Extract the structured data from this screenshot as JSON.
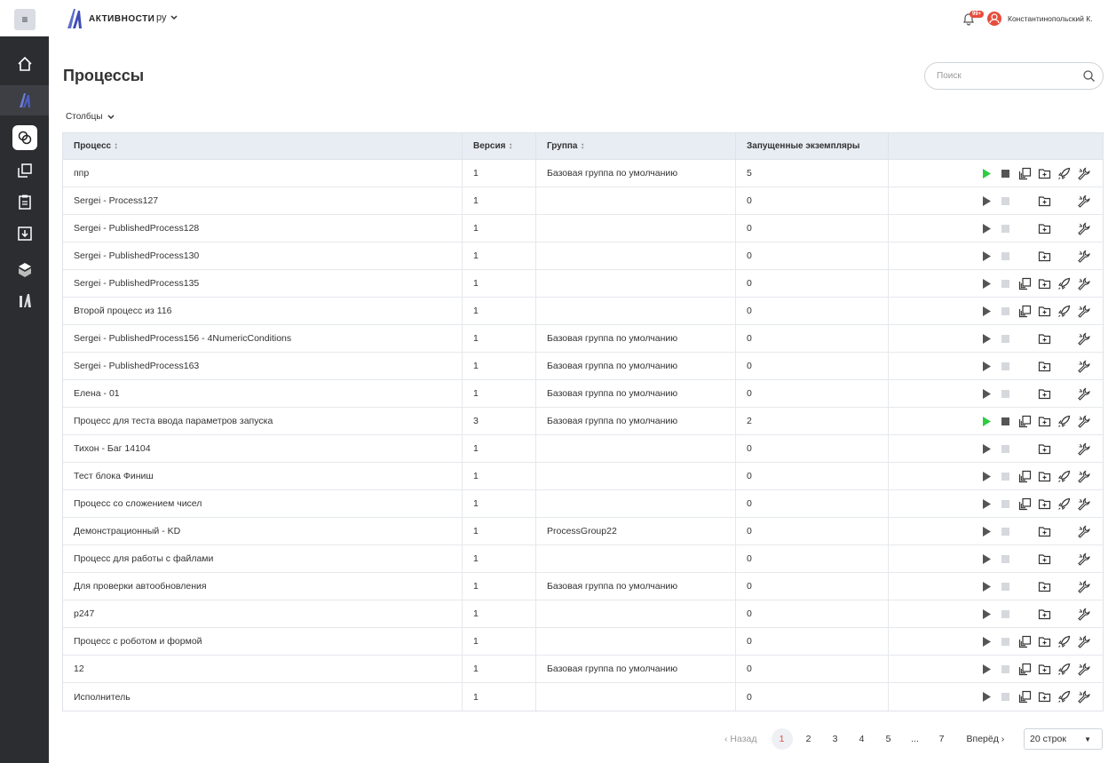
{
  "header": {
    "menu_icon": "hamburger-icon",
    "app_title": "АКТИВНОСТИ",
    "language": "ру",
    "notifications_badge": "99+",
    "user_name": "Константинопольский К."
  },
  "sidebar": {
    "items": [
      {
        "icon": "home-icon"
      },
      {
        "icon": "activities-logo-icon"
      },
      {
        "icon": "processes-icon"
      },
      {
        "icon": "copy-icon"
      },
      {
        "icon": "clipboard-icon"
      },
      {
        "icon": "inbox-download-icon"
      },
      {
        "icon": "package-icon"
      },
      {
        "icon": "alt-logo-icon"
      }
    ]
  },
  "main": {
    "title": "Процессы",
    "search_placeholder": "Поиск",
    "columns_label": "Столбцы",
    "columns": [
      {
        "label": "Процесс",
        "sortable": true
      },
      {
        "label": "Версия",
        "sortable": true
      },
      {
        "label": "Группа",
        "sortable": true
      },
      {
        "label": "Запущенные экземпляры",
        "sortable": false
      },
      {
        "label": "",
        "sortable": false
      }
    ],
    "rows": [
      {
        "name": "ппр",
        "version": "1",
        "group": "Базовая группа по умолчанию",
        "instances": "5",
        "running": true,
        "copy": true,
        "rocket": true
      },
      {
        "name": "Sergei - Process127",
        "version": "1",
        "group": "",
        "instances": "0",
        "running": false,
        "copy": false,
        "rocket": false
      },
      {
        "name": "Sergei - PublishedProcess128",
        "version": "1",
        "group": "",
        "instances": "0",
        "running": false,
        "copy": false,
        "rocket": false
      },
      {
        "name": "Sergei - PublishedProcess130",
        "version": "1",
        "group": "",
        "instances": "0",
        "running": false,
        "copy": false,
        "rocket": false
      },
      {
        "name": "Sergei - PublishedProcess135",
        "version": "1",
        "group": "",
        "instances": "0",
        "running": false,
        "copy": true,
        "rocket": true
      },
      {
        "name": "Второй процесс из 116",
        "version": "1",
        "group": "",
        "instances": "0",
        "running": false,
        "copy": true,
        "rocket": true
      },
      {
        "name": "Sergei - PublishedProcess156 - 4NumericConditions",
        "version": "1",
        "group": "Базовая группа по умолчанию",
        "instances": "0",
        "running": false,
        "copy": false,
        "rocket": false
      },
      {
        "name": "Sergei - PublishedProcess163",
        "version": "1",
        "group": "Базовая группа по умолчанию",
        "instances": "0",
        "running": false,
        "copy": false,
        "rocket": false
      },
      {
        "name": "Елена - 01",
        "version": "1",
        "group": "Базовая группа по умолчанию",
        "instances": "0",
        "running": false,
        "copy": false,
        "rocket": false
      },
      {
        "name": "Процесс для теста ввода параметров запуска",
        "version": "3",
        "group": "Базовая группа по умолчанию",
        "instances": "2",
        "running": true,
        "copy": true,
        "rocket": true
      },
      {
        "name": "Тихон - Баг 14104",
        "version": "1",
        "group": "",
        "instances": "0",
        "running": false,
        "copy": false,
        "rocket": false
      },
      {
        "name": "Тест блока Финиш",
        "version": "1",
        "group": "",
        "instances": "0",
        "running": false,
        "copy": true,
        "rocket": true
      },
      {
        "name": "Процесс со сложением чисел",
        "version": "1",
        "group": "",
        "instances": "0",
        "running": false,
        "copy": true,
        "rocket": true
      },
      {
        "name": "Демонстрационный - KD",
        "version": "1",
        "group": "ProcessGroup22",
        "instances": "0",
        "running": false,
        "copy": false,
        "rocket": false
      },
      {
        "name": "Процесс для работы с файлами",
        "version": "1",
        "group": "",
        "instances": "0",
        "running": false,
        "copy": false,
        "rocket": false
      },
      {
        "name": "Для проверки автообновления",
        "version": "1",
        "group": "Базовая группа по умолчанию",
        "instances": "0",
        "running": false,
        "copy": false,
        "rocket": false
      },
      {
        "name": "p247",
        "version": "1",
        "group": "",
        "instances": "0",
        "running": false,
        "copy": false,
        "rocket": false
      },
      {
        "name": "Процесс с роботом и формой",
        "version": "1",
        "group": "",
        "instances": "0",
        "running": false,
        "copy": true,
        "rocket": true
      },
      {
        "name": "12",
        "version": "1",
        "group": "Базовая группа по умолчанию",
        "instances": "0",
        "running": false,
        "copy": true,
        "rocket": true
      },
      {
        "name": "Исполнитель",
        "version": "1",
        "group": "",
        "instances": "0",
        "running": false,
        "copy": true,
        "rocket": true
      }
    ]
  },
  "pagination": {
    "prev_label": "‹ Назад",
    "next_label": "Вперёд ›",
    "pages": [
      "1",
      "2",
      "3",
      "4",
      "5",
      "...",
      "7"
    ],
    "current_page": "1",
    "rows_per_page": "20 строк"
  },
  "colors": {
    "accent_red": "#e74c3c",
    "play_active": "#2ecc40",
    "sidebar_bg": "#2b2d31",
    "header_row_bg": "#e8edf3"
  }
}
